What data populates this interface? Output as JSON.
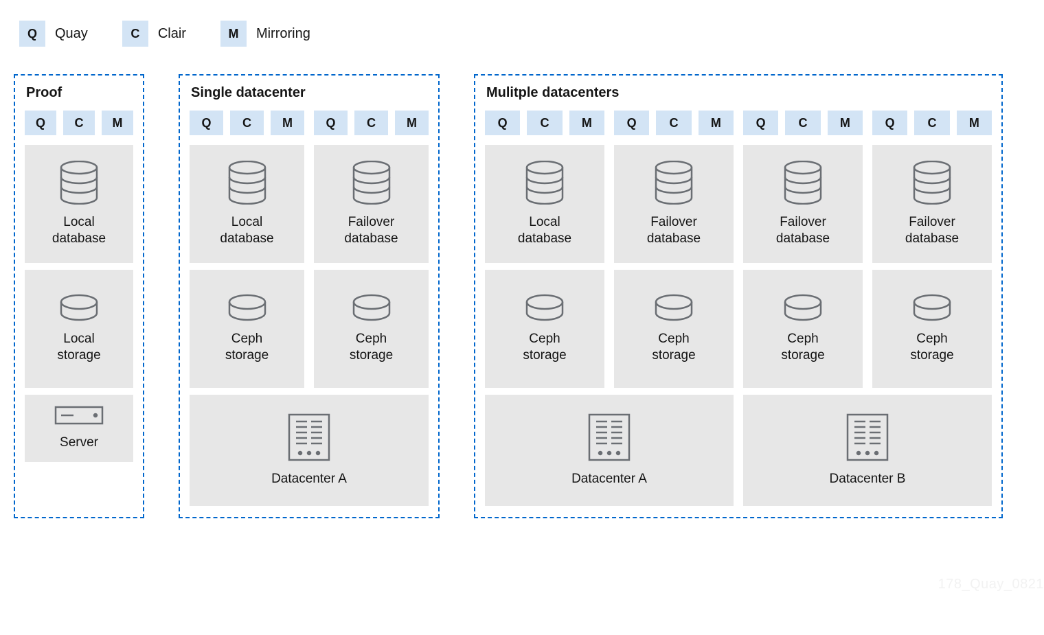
{
  "legend": [
    {
      "abbr": "Q",
      "label": "Quay"
    },
    {
      "abbr": "C",
      "label": "Clair"
    },
    {
      "abbr": "M",
      "label": "Mirroring"
    }
  ],
  "panels": {
    "proof": {
      "title": "Proof",
      "columns": [
        {
          "qcm": [
            "Q",
            "C",
            "M"
          ],
          "tiles": [
            {
              "icon": "database",
              "label": "Local\ndatabase"
            },
            {
              "icon": "disk",
              "label": "Local\nstorage"
            }
          ]
        }
      ],
      "bottom": [
        {
          "icon": "server",
          "label": "Server"
        }
      ]
    },
    "single": {
      "title": "Single datacenter",
      "columns": [
        {
          "qcm": [
            "Q",
            "C",
            "M"
          ],
          "tiles": [
            {
              "icon": "database",
              "label": "Local\ndatabase"
            },
            {
              "icon": "disk",
              "label": "Ceph\nstorage"
            }
          ]
        },
        {
          "qcm": [
            "Q",
            "C",
            "M"
          ],
          "tiles": [
            {
              "icon": "database",
              "label": "Failover\ndatabase"
            },
            {
              "icon": "disk",
              "label": "Ceph\nstorage"
            }
          ]
        }
      ],
      "bottom": [
        {
          "icon": "datacenter",
          "label": "Datacenter A"
        }
      ]
    },
    "multi": {
      "title": "Mulitple datacenters",
      "columns": [
        {
          "qcm": [
            "Q",
            "C",
            "M"
          ],
          "tiles": [
            {
              "icon": "database",
              "label": "Local\ndatabase"
            },
            {
              "icon": "disk",
              "label": "Ceph\nstorage"
            }
          ]
        },
        {
          "qcm": [
            "Q",
            "C",
            "M"
          ],
          "tiles": [
            {
              "icon": "database",
              "label": "Failover\ndatabase"
            },
            {
              "icon": "disk",
              "label": "Ceph\nstorage"
            }
          ]
        },
        {
          "qcm": [
            "Q",
            "C",
            "M"
          ],
          "tiles": [
            {
              "icon": "database",
              "label": "Failover\ndatabase"
            },
            {
              "icon": "disk",
              "label": "Ceph\nstorage"
            }
          ]
        },
        {
          "qcm": [
            "Q",
            "C",
            "M"
          ],
          "tiles": [
            {
              "icon": "database",
              "label": "Failover\ndatabase"
            },
            {
              "icon": "disk",
              "label": "Ceph\nstorage"
            }
          ]
        }
      ],
      "bottom": [
        {
          "icon": "datacenter",
          "label": "Datacenter A"
        },
        {
          "icon": "datacenter",
          "label": "Datacenter B"
        }
      ]
    }
  },
  "watermark": "178_Quay_0821"
}
